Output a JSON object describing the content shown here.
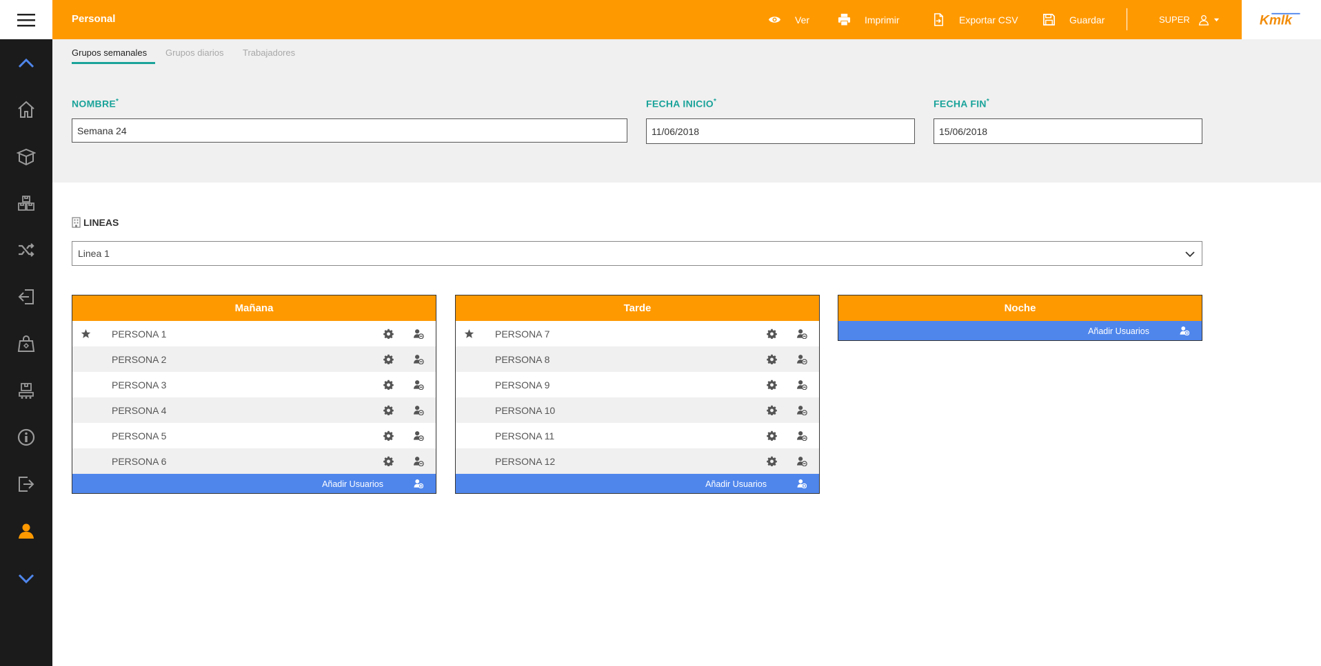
{
  "header": {
    "title": "Personal",
    "actions": [
      {
        "id": "ver",
        "label": "Ver",
        "icon": "eye-icon"
      },
      {
        "id": "imprimir",
        "label": "Imprimir",
        "icon": "printer-icon"
      },
      {
        "id": "exportar",
        "label": "Exportar CSV",
        "icon": "export-file-icon"
      },
      {
        "id": "guardar",
        "label": "Guardar",
        "icon": "save-icon"
      }
    ],
    "user": "SUPER",
    "logo_text": "Kmlk"
  },
  "sidebar": {
    "items": [
      {
        "icon": "chevron-up-icon"
      },
      {
        "icon": "home-icon"
      },
      {
        "icon": "open-box-icon"
      },
      {
        "icon": "stacked-boxes-icon"
      },
      {
        "icon": "shuffle-icon"
      },
      {
        "icon": "sign-in-icon"
      },
      {
        "icon": "shopping-bag-icon"
      },
      {
        "icon": "conveyor-icon"
      },
      {
        "icon": "info-icon"
      },
      {
        "icon": "sign-out-icon"
      },
      {
        "icon": "user-icon",
        "active": true
      },
      {
        "icon": "chevron-down-icon"
      }
    ]
  },
  "tabs": [
    {
      "label": "Grupos semanales",
      "active": true
    },
    {
      "label": "Grupos diarios",
      "active": false
    },
    {
      "label": "Trabajadores",
      "active": false
    }
  ],
  "form": {
    "nombre": {
      "label": "NOMBRE",
      "required": "*",
      "value": "Semana 24"
    },
    "fecha_inicio": {
      "label": "FECHA INICIO",
      "required": "*",
      "value": "11/06/2018"
    },
    "fecha_fin": {
      "label": "FECHA FIN",
      "required": "*",
      "value": "15/06/2018"
    }
  },
  "lineas": {
    "label": "LINEAS",
    "selected": "Linea 1"
  },
  "shifts": [
    {
      "title": "Mañana",
      "people": [
        {
          "name": "PERSONA 1",
          "star": true
        },
        {
          "name": "PERSONA 2",
          "star": false
        },
        {
          "name": "PERSONA 3",
          "star": false
        },
        {
          "name": "PERSONA 4",
          "star": false
        },
        {
          "name": "PERSONA 5",
          "star": false
        },
        {
          "name": "PERSONA 6",
          "star": false
        }
      ],
      "add_label": "Añadir Usuarios"
    },
    {
      "title": "Tarde",
      "people": [
        {
          "name": "PERSONA 7",
          "star": true
        },
        {
          "name": "PERSONA 8",
          "star": false
        },
        {
          "name": "PERSONA 9",
          "star": false
        },
        {
          "name": "PERSONA 10",
          "star": false
        },
        {
          "name": "PERSONA 11",
          "star": false
        },
        {
          "name": "PERSONA 12",
          "star": false
        }
      ],
      "add_label": "Añadir Usuarios"
    },
    {
      "title": "Noche",
      "people": [],
      "add_label": "Añadir Usuarios"
    }
  ],
  "colors": {
    "accent": "#ff9900",
    "teal": "#1aa39a",
    "blue": "#4f86ec",
    "sidebar": "#1b1b1b",
    "sidebar_icon": "#9a9a9a",
    "sidebar_arrow": "#4f86ec"
  }
}
